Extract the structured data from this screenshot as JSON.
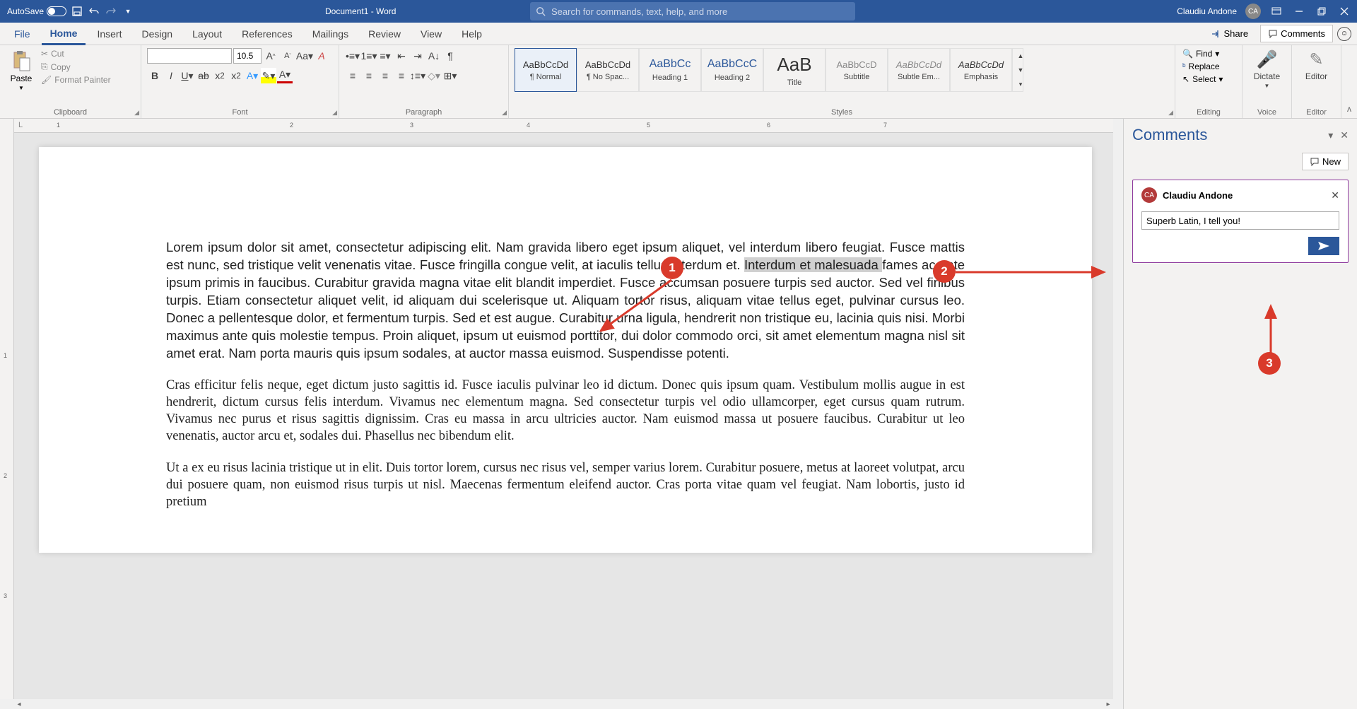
{
  "title": {
    "autosave": "AutoSave",
    "docname": "Document1  -  Word",
    "search_placeholder": "Search for commands, text, help, and more",
    "user": "Claudiu Andone",
    "initials": "CA"
  },
  "tabs": {
    "file": "File",
    "items": [
      "Home",
      "Insert",
      "Design",
      "Layout",
      "References",
      "Mailings",
      "Review",
      "View",
      "Help"
    ],
    "active": "Home",
    "share": "Share",
    "comments": "Comments"
  },
  "ribbon": {
    "clipboard": {
      "label": "Clipboard",
      "paste": "Paste",
      "cut": "Cut",
      "copy": "Copy",
      "fp": "Format Painter"
    },
    "font": {
      "label": "Font",
      "size": "10.5"
    },
    "paragraph": {
      "label": "Paragraph"
    },
    "styles": {
      "label": "Styles",
      "items": [
        {
          "prev": "AaBbCcDd",
          "name": "¶ Normal"
        },
        {
          "prev": "AaBbCcDd",
          "name": "¶ No Spac..."
        },
        {
          "prev": "AaBbCc",
          "name": "Heading 1"
        },
        {
          "prev": "AaBbCcC",
          "name": "Heading 2"
        },
        {
          "prev": "AaB",
          "name": "Title"
        },
        {
          "prev": "AaBbCcD",
          "name": "Subtitle"
        },
        {
          "prev": "AaBbCcDd",
          "name": "Subtle Em..."
        },
        {
          "prev": "AaBbCcDd",
          "name": "Emphasis"
        }
      ]
    },
    "editing": {
      "label": "Editing",
      "find": "Find",
      "replace": "Replace",
      "select": "Select"
    },
    "voice": {
      "label": "Voice",
      "dictate": "Dictate"
    },
    "editor": {
      "label": "Editor",
      "btn": "Editor"
    }
  },
  "comments_pane": {
    "title": "Comments",
    "new": "New",
    "author": "Claudiu Andone",
    "initials": "CA",
    "input_value": "Superb Latin, I tell you!"
  },
  "document": {
    "p1a": "Lorem ipsum dolor sit amet, consectetur adipiscing elit. Nam gravida libero eget ipsum aliquet, vel interdum libero feugiat. Fusce mattis est nunc, sed tristique velit venenatis vitae. Fusce fringilla congue velit, at iaculis tellus interdum et. ",
    "p1sel": "Interdum et malesuada ",
    "p1b": "fames ac ante ipsum primis in faucibus. Curabitur gravida magna vitae elit blandit imperdiet. Fusce accumsan posuere turpis sed auctor. Sed vel finibus turpis. Etiam consectetur aliquet velit, id aliquam dui scelerisque ut. Aliquam tortor risus, aliquam vitae tellus eget, pulvinar cursus leo. Donec a pellentesque dolor, et fermentum turpis. Sed et est augue. Curabitur urna ligula, hendrerit non tristique eu, lacinia quis nisi. Morbi maximus ante quis molestie tempus. Proin aliquet, ipsum ut euismod porttitor, dui dolor commodo orci, sit amet elementum magna nisl sit amet erat. Nam porta mauris quis ipsum sodales, at auctor massa euismod. Suspendisse potenti.",
    "p2": "Cras efficitur felis neque, eget dictum justo sagittis id. Fusce iaculis pulvinar leo id dictum. Donec quis ipsum quam. Vestibulum mollis augue in est hendrerit, dictum cursus felis interdum. Vivamus nec elementum magna. Sed consectetur turpis vel odio ullamcorper, eget cursus quam rutrum. Vivamus nec purus et risus sagittis dignissim. Cras eu massa in arcu ultricies auctor. Nam euismod massa ut posuere faucibus. Curabitur ut leo venenatis, auctor arcu et, sodales dui. Phasellus nec bibendum elit.",
    "p3": "Ut a ex eu risus lacinia tristique ut in elit. Duis tortor lorem, cursus nec risus vel, semper varius lorem. Curabitur posuere, metus at laoreet volutpat, arcu dui posuere quam, non euismod risus turpis ut nisl. Maecenas fermentum eleifend auctor. Cras porta vitae quam vel feugiat. Nam lobortis, justo id pretium"
  },
  "ruler_marks": [
    "1",
    "2",
    "3",
    "4",
    "5",
    "6",
    "7"
  ],
  "ruler_v_marks": [
    "1",
    "2",
    "3"
  ],
  "annotations": {
    "a1": "1",
    "a2": "2",
    "a3": "3"
  }
}
